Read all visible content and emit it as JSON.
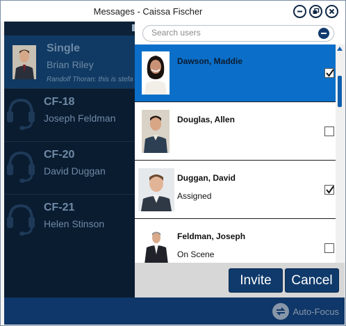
{
  "window": {
    "title": "Messages - Caissa Fischer",
    "controls": [
      "minimize-icon",
      "restore-icon",
      "close-icon"
    ]
  },
  "conversations": [
    {
      "title": "Single",
      "subtitle": "Brian Riley",
      "preview": "Randolf Thoran: this is stefa",
      "type": "single"
    },
    {
      "title": "CF-18",
      "subtitle": "Joseph Feldman",
      "type": "group"
    },
    {
      "title": "CF-20",
      "subtitle": "David Duggan",
      "type": "group"
    },
    {
      "title": "CF-21",
      "subtitle": "Helen Stinson",
      "type": "group"
    }
  ],
  "search": {
    "placeholder": "Search users"
  },
  "users": [
    {
      "name": "Dawson, Maddie",
      "status": "",
      "checked": true,
      "selected": true
    },
    {
      "name": "Douglas, Allen",
      "status": "",
      "checked": false,
      "selected": false
    },
    {
      "name": "Duggan, David",
      "status": "Assigned",
      "checked": true,
      "selected": false
    },
    {
      "name": "Feldman, Joseph",
      "status": "On Scene",
      "checked": false,
      "selected": false
    }
  ],
  "actions": {
    "invite_label": "Invite",
    "cancel_label": "Cancel"
  },
  "footer": {
    "autofocus_label": "Auto-Focus"
  },
  "colors": {
    "selected_row": "#0b6fc9",
    "button": "#0f3a6b",
    "left_bg": "#0a1c30",
    "bottom_bar": "#0f3769"
  }
}
